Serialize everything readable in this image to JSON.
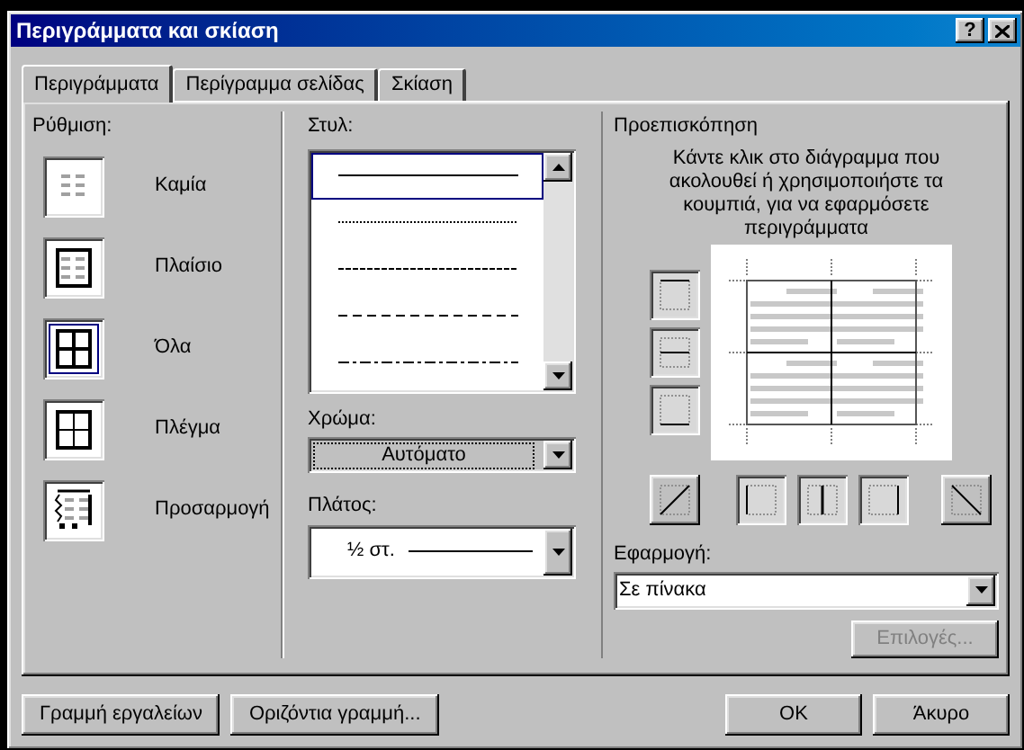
{
  "window": {
    "title": "Περιγράμματα και σκίαση",
    "help": "?"
  },
  "tabs": [
    {
      "label": "Περιγράμματα",
      "selected": true
    },
    {
      "label": "Περίγραμμα σελίδας",
      "selected": false
    },
    {
      "label": "Σκίαση",
      "selected": false
    }
  ],
  "settings": {
    "label": "Ρύθμιση:",
    "items": [
      {
        "label": "Καμία",
        "kind": "none",
        "selected": false
      },
      {
        "label": "Πλαίσιο",
        "kind": "box",
        "selected": false
      },
      {
        "label": "Όλα",
        "kind": "all",
        "selected": true
      },
      {
        "label": "Πλέγμα",
        "kind": "grid",
        "selected": false
      },
      {
        "label": "Προσαρμογή",
        "kind": "custom",
        "selected": false
      }
    ]
  },
  "style": {
    "label": "Στυλ:",
    "items": [
      {
        "kind": "solid",
        "selected": true
      },
      {
        "kind": "dotted",
        "selected": false
      },
      {
        "kind": "fine-dashed",
        "selected": false
      },
      {
        "kind": "dashed",
        "selected": false
      },
      {
        "kind": "dash-dot",
        "selected": false
      }
    ]
  },
  "color": {
    "label": "Χρώμα:",
    "value": "Αυτόματο"
  },
  "width": {
    "label": "Πλάτος:",
    "value": "½ στ."
  },
  "preview": {
    "label": "Προεπισκόπηση",
    "hint": "Κάντε κλικ στο διάγραμμα που ακολουθεί ή χρησιμοποιήστε τα κουμπιά, για να εφαρμόσετε περιγράμματα",
    "side_buttons": [
      {
        "kind": "top",
        "on": true
      },
      {
        "kind": "inside-horizontal",
        "on": true
      },
      {
        "kind": "bottom",
        "on": true
      }
    ],
    "bottom_buttons": [
      {
        "kind": "diagonal-up",
        "on": false
      },
      {
        "kind": "left",
        "on": true
      },
      {
        "kind": "inside-vertical",
        "on": true
      },
      {
        "kind": "right",
        "on": true
      },
      {
        "kind": "diagonal-down",
        "on": false
      }
    ]
  },
  "apply": {
    "label": "Εφαρμογή:",
    "value": "Σε πίνακα"
  },
  "options_button": {
    "label": "Επιλογές...",
    "disabled": true
  },
  "footer_buttons": [
    {
      "label": "Γραμμή εργαλείων"
    },
    {
      "label": "Οριζόντια γραμμή..."
    },
    {
      "label": "OK"
    },
    {
      "label": "Άκυρο"
    }
  ]
}
